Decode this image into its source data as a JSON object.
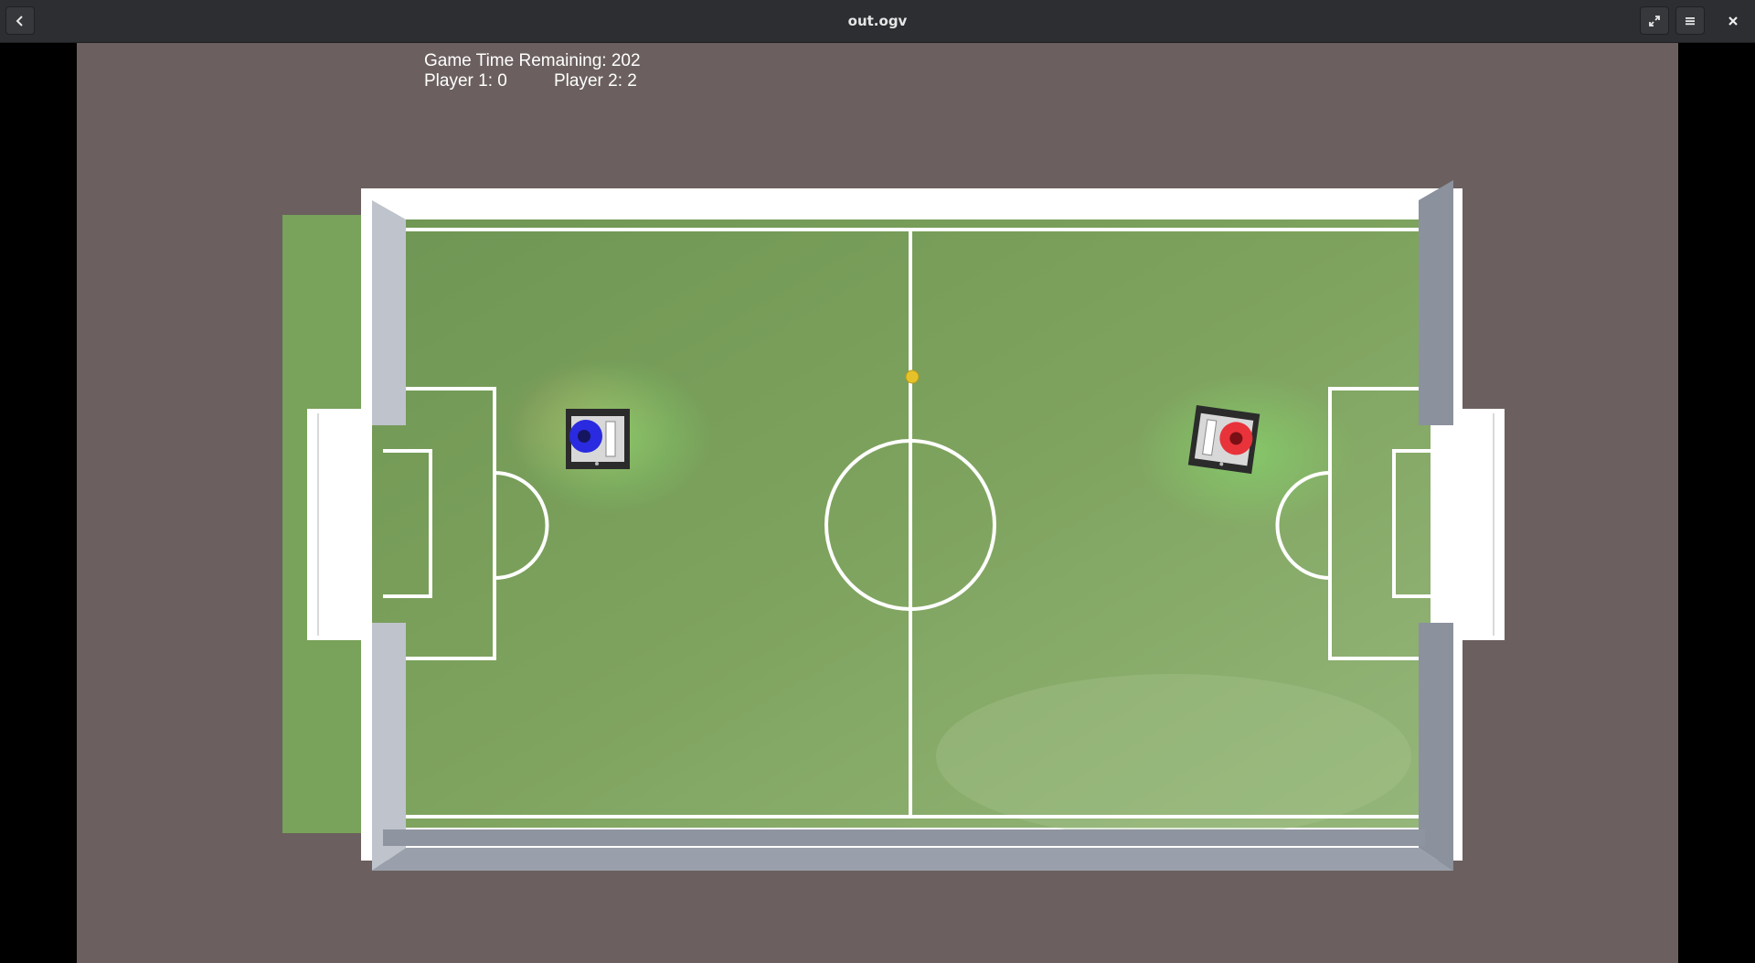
{
  "window": {
    "title": "out.ogv",
    "back_icon": "back-arrow-icon",
    "fullscreen_icon": "fullscreen-icon",
    "menu_icon": "hamburger-menu-icon",
    "close_icon": "close-icon"
  },
  "hud": {
    "time_label": "Game Time Remaining: 202",
    "player1_label": "Player 1: 0",
    "player2_label": "Player 2: 2"
  },
  "colors": {
    "background": "#6b605f",
    "field_green": "#7fa35e",
    "player1": "#2a2ae0",
    "player2": "#e8333b",
    "ball": "#e6c22a"
  }
}
